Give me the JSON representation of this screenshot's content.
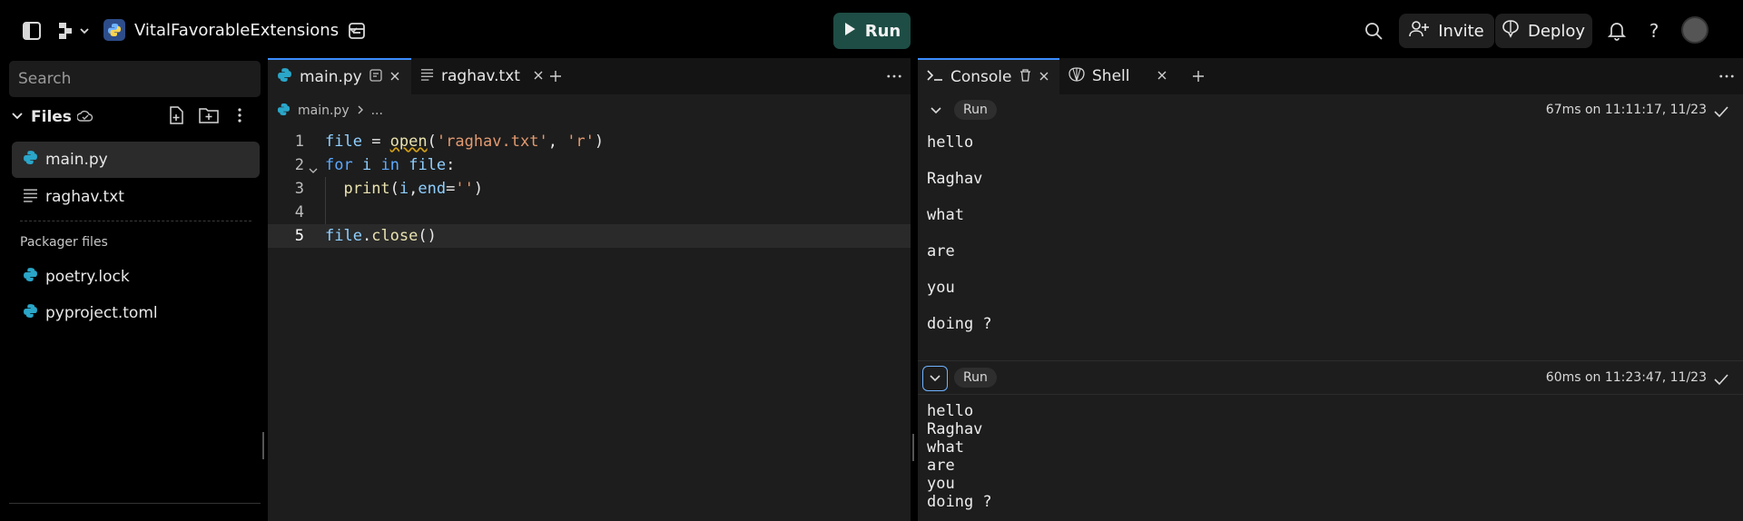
{
  "topbar": {
    "repl_name": "VitalFavorableExtensions",
    "run_label": "Run",
    "invite_label": "Invite",
    "deploy_label": "Deploy"
  },
  "sidebar": {
    "search_placeholder": "Search",
    "files_title": "Files",
    "files": [
      {
        "name": "main.py",
        "icon": "python-icon",
        "active": true
      },
      {
        "name": "raghav.txt",
        "icon": "text-file-icon",
        "active": false
      }
    ],
    "packager_title": "Packager files",
    "packager_files": [
      {
        "name": "poetry.lock",
        "icon": "python-icon"
      },
      {
        "name": "pyproject.toml",
        "icon": "python-icon"
      }
    ]
  },
  "editor": {
    "tabs": [
      {
        "label": "main.py",
        "icon": "python-icon",
        "active": true
      },
      {
        "label": "raghav.txt",
        "icon": "text-file-icon",
        "active": false
      }
    ],
    "breadcrumb": {
      "file": "main.py",
      "trail": "..."
    },
    "lines": [
      {
        "num": "1",
        "text": "file = open('raghav.txt', 'r')"
      },
      {
        "num": "2",
        "text": "for i in file:"
      },
      {
        "num": "3",
        "text": "  print(i,end='')"
      },
      {
        "num": "4",
        "text": ""
      },
      {
        "num": "5",
        "text": "file.close()"
      }
    ]
  },
  "console": {
    "tabs": [
      {
        "label": "Console",
        "icon": "console-icon",
        "active": true
      },
      {
        "label": "Shell",
        "icon": "shell-icon",
        "active": false
      }
    ],
    "runs": [
      {
        "chip": "Run",
        "meta": "67ms on 11:11:17, 11/23",
        "output": [
          "hello",
          "Raghav",
          "what",
          "are",
          "you",
          "doing ?"
        ]
      },
      {
        "chip": "Run",
        "meta": "60ms on 11:23:47, 11/23",
        "output": [
          "hello",
          "Raghav",
          "what",
          "are",
          "you",
          "doing ?"
        ]
      }
    ]
  },
  "colors": {
    "run_button": "#1e4d45",
    "active_tab_accent": "#3c8dff",
    "python_icon": "#2aa6c9"
  }
}
